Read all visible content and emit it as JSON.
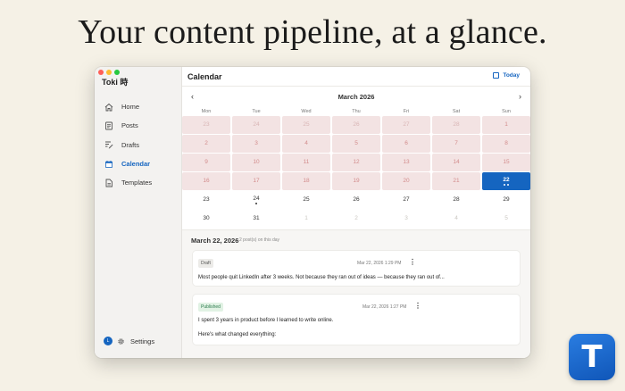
{
  "headline": "Your content pipeline, at a glance.",
  "window": {
    "traffic_lights": [
      "#ff5f57",
      "#febc2e",
      "#28c840"
    ]
  },
  "sidebar": {
    "app_title": "Toki 時",
    "items": [
      {
        "label": "Home",
        "icon": "home-icon",
        "active": false
      },
      {
        "label": "Posts",
        "icon": "posts-icon",
        "active": false
      },
      {
        "label": "Drafts",
        "icon": "drafts-icon",
        "active": false
      },
      {
        "label": "Calendar",
        "icon": "calendar-icon",
        "active": true
      },
      {
        "label": "Templates",
        "icon": "templates-icon",
        "active": false
      }
    ],
    "avatar_initial": "L",
    "settings_label": "Settings"
  },
  "header": {
    "title": "Calendar",
    "today_label": "Today"
  },
  "calendar": {
    "month_label": "March 2026",
    "prev_label": "‹",
    "next_label": "›",
    "weekdays": [
      "Mon",
      "Tue",
      "Wed",
      "Thu",
      "Fri",
      "Sat",
      "Sun"
    ],
    "weeks": [
      [
        {
          "d": "23",
          "s": "past-other"
        },
        {
          "d": "24",
          "s": "past-other"
        },
        {
          "d": "25",
          "s": "past-other"
        },
        {
          "d": "26",
          "s": "past-other"
        },
        {
          "d": "27",
          "s": "past-other"
        },
        {
          "d": "28",
          "s": "past-other"
        },
        {
          "d": "1",
          "s": "past"
        }
      ],
      [
        {
          "d": "2",
          "s": "past"
        },
        {
          "d": "3",
          "s": "past"
        },
        {
          "d": "4",
          "s": "past"
        },
        {
          "d": "5",
          "s": "past"
        },
        {
          "d": "6",
          "s": "past"
        },
        {
          "d": "7",
          "s": "past"
        },
        {
          "d": "8",
          "s": "past"
        }
      ],
      [
        {
          "d": "9",
          "s": "past"
        },
        {
          "d": "10",
          "s": "past"
        },
        {
          "d": "11",
          "s": "past"
        },
        {
          "d": "12",
          "s": "past"
        },
        {
          "d": "13",
          "s": "past"
        },
        {
          "d": "14",
          "s": "past"
        },
        {
          "d": "15",
          "s": "past"
        }
      ],
      [
        {
          "d": "16",
          "s": "past"
        },
        {
          "d": "17",
          "s": "past"
        },
        {
          "d": "18",
          "s": "past"
        },
        {
          "d": "19",
          "s": "past"
        },
        {
          "d": "20",
          "s": "past"
        },
        {
          "d": "21",
          "s": "past"
        },
        {
          "d": "22",
          "s": "selected",
          "dots": 2
        }
      ],
      [
        {
          "d": "23",
          "s": "normal"
        },
        {
          "d": "24",
          "s": "normal",
          "dots": 1
        },
        {
          "d": "25",
          "s": "normal"
        },
        {
          "d": "26",
          "s": "normal"
        },
        {
          "d": "27",
          "s": "normal"
        },
        {
          "d": "28",
          "s": "normal"
        },
        {
          "d": "29",
          "s": "normal"
        }
      ],
      [
        {
          "d": "30",
          "s": "normal"
        },
        {
          "d": "31",
          "s": "normal"
        },
        {
          "d": "1",
          "s": "other"
        },
        {
          "d": "2",
          "s": "other"
        },
        {
          "d": "3",
          "s": "other"
        },
        {
          "d": "4",
          "s": "other"
        },
        {
          "d": "5",
          "s": "other"
        }
      ]
    ]
  },
  "day_view": {
    "title": "March 22, 2026",
    "count": "2 post(s) on this day",
    "posts": [
      {
        "status": "Draft",
        "date": "Mar 22, 2026 1:29 PM",
        "more": "⋮",
        "lines": [
          "Most people quit LinkedIn after 3 weeks. Not because they ran out of ideas — because they ran out of..."
        ]
      },
      {
        "status": "Published",
        "date": "Mar 22, 2026 1:27 PM",
        "more": "⋮",
        "lines": [
          "I spent 3 years in product before I learned to write online.",
          "Here's what changed everything:"
        ]
      }
    ]
  },
  "app_icon": {
    "glyph": "T",
    "icon": "toki-app-icon"
  },
  "colors": {
    "accent": "#1565c0",
    "past_bg": "#f3e3e3",
    "past_text": "#d28b8b",
    "page_bg": "#f5f1e6"
  }
}
